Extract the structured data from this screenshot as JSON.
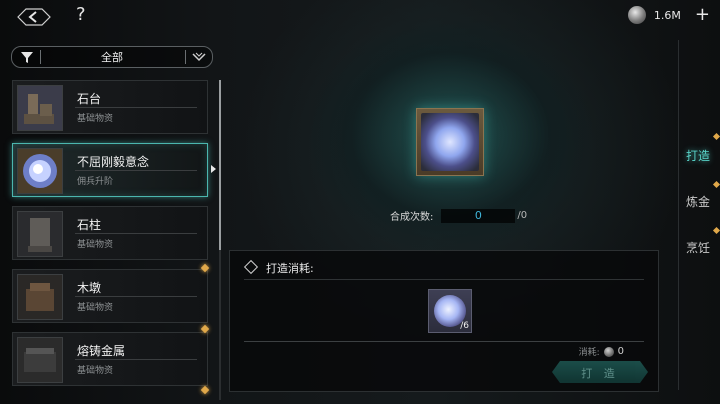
{
  "topbar": {
    "help_label": "?",
    "currency_value": "1.6M",
    "plus_label": "+"
  },
  "filter": {
    "label": "全部"
  },
  "items": [
    {
      "name": "石台",
      "sub": "基础物资",
      "diamond": false
    },
    {
      "name": "不屈刚毅意念",
      "sub": "佣兵升阶",
      "diamond": false,
      "selected": true
    },
    {
      "name": "石柱",
      "sub": "基础物资",
      "diamond": true
    },
    {
      "name": "木墩",
      "sub": "基础物资",
      "diamond": true
    },
    {
      "name": "熔铸金属",
      "sub": "基础物资",
      "diamond": true
    }
  ],
  "result": {
    "count_label": "合成次数:",
    "count_value": "0",
    "count_max": "/0"
  },
  "tabs": {
    "forge": "打造",
    "alchemy": "炼金",
    "cook": "烹饪"
  },
  "cost": {
    "title": "打造消耗:",
    "item_count": "/6",
    "consume_label": "消耗:",
    "consume_value": "0",
    "forge_button": "打 造"
  },
  "colors": {
    "accent": "#58d3c8",
    "selected_border": "#4bb6ae",
    "diamond": "#e0a84a"
  }
}
